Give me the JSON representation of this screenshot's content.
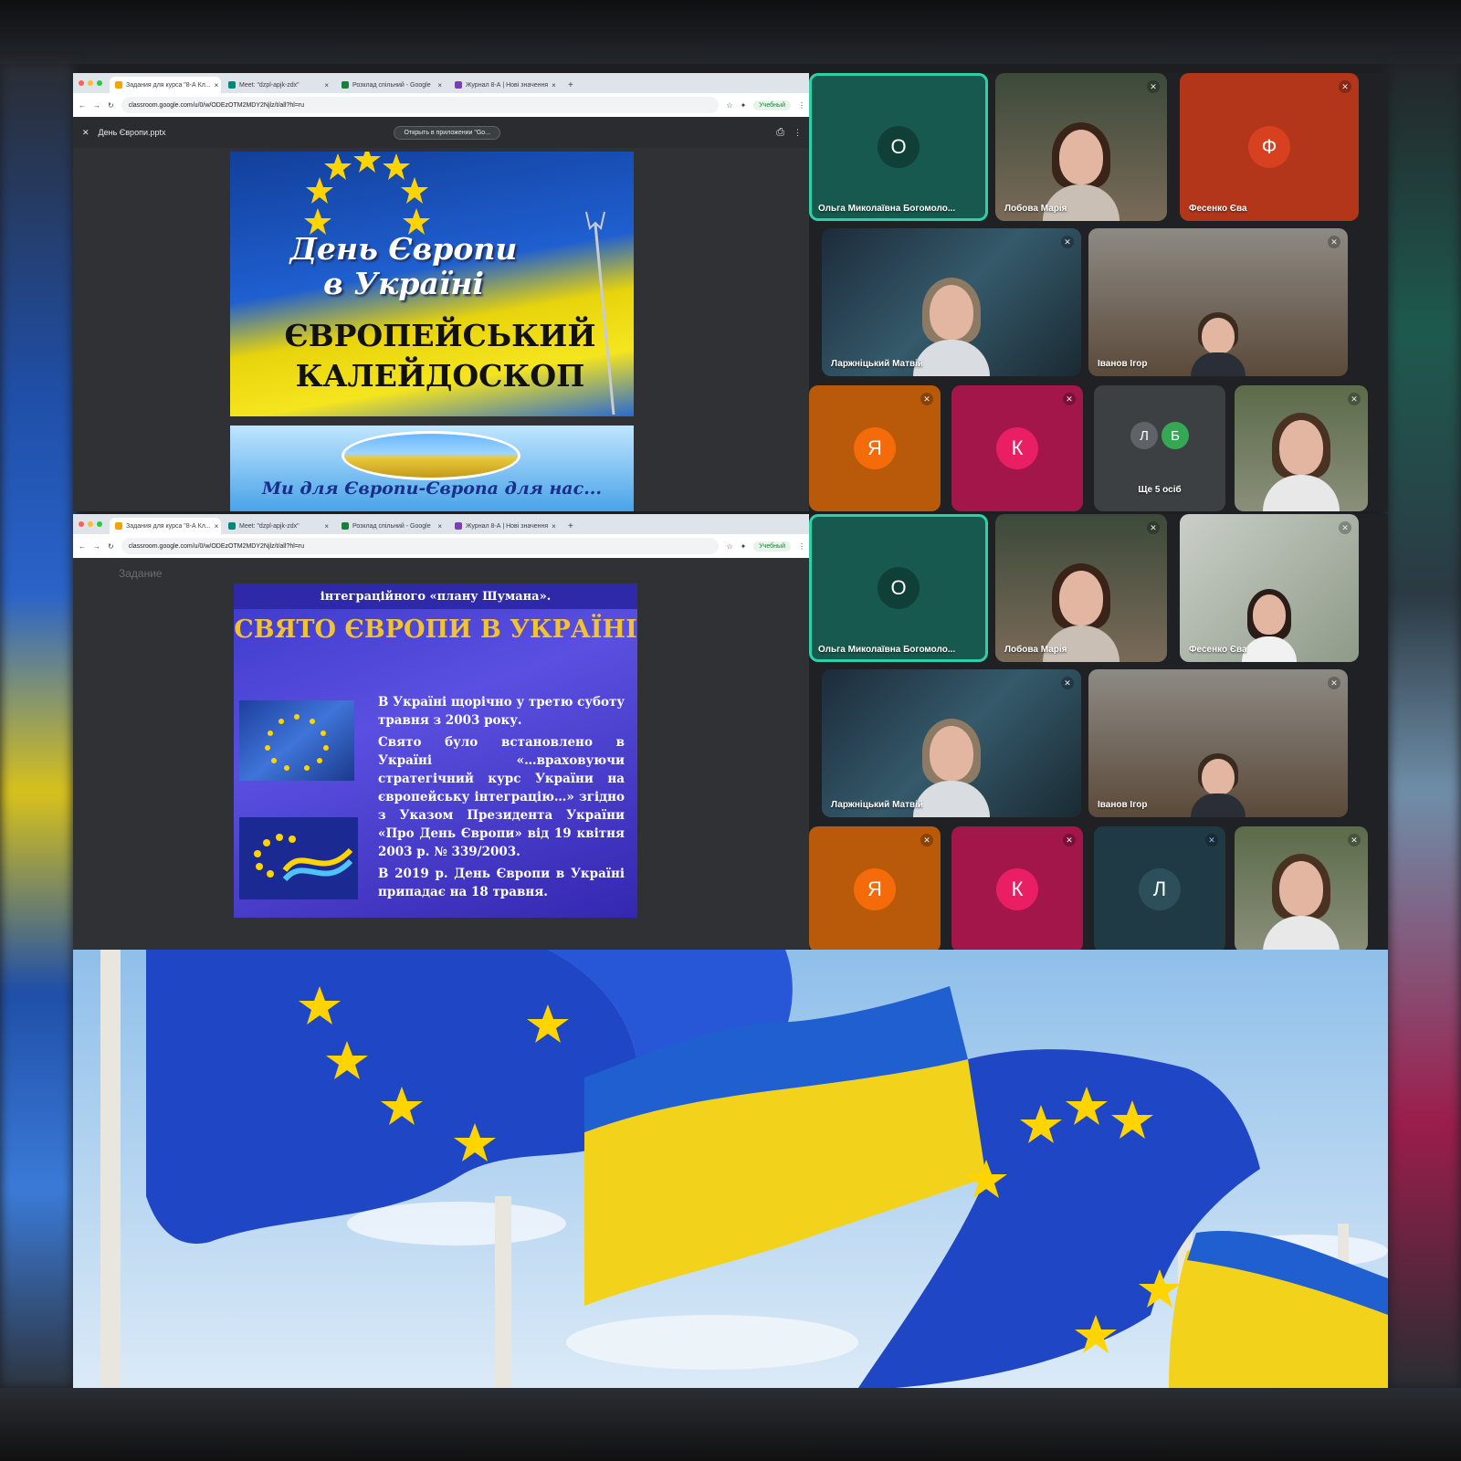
{
  "colors": {
    "eu_blue": "#1f46c4",
    "ua_yellow": "#f2d21a",
    "meet_teal": "#17594e",
    "avatar_orange": "#f56b0a",
    "avatar_pink": "#e91e63",
    "speaking": "#2fd0a8"
  },
  "screens": [
    {
      "tabs": [
        {
          "label": "Задания для курса \"8-А Кл...",
          "fav": "#f4a300"
        },
        {
          "label": "Meet: \"dzpl-apjk-zdx\"",
          "fav": "#00897b"
        },
        {
          "label": "Розклад спільний - Google",
          "fav": "#188038"
        },
        {
          "label": "Журнал 8-А | Нові значення",
          "fav": "#7b3fb5"
        }
      ],
      "url": "classroom.google.com/u/0/w/ODEzOTM2MDY2Njlz/t/all?hl=ru",
      "profile": "Учебный",
      "file_name": "День Європи.pptx",
      "open_button": "Открыть в приложении \"Go...",
      "slide": {
        "title": "День Європи в Україні",
        "subtitle": "ЄВРОПЕЙСЬКИЙ КАЛЕЙДОСКОП",
        "next_caption": "Ми для Європи-Європа для нас..."
      },
      "participants": [
        {
          "name": "Ольга Миколаївна Богомоло...",
          "initial": "О"
        },
        {
          "name": "Лобова Марія"
        },
        {
          "name": "Фесенко Єва",
          "initial": "Ф"
        },
        {
          "name": "Ларжніцький Матвій"
        },
        {
          "name": "Іванов Ігор"
        },
        {
          "initial": "Я"
        },
        {
          "initial": "К"
        },
        {
          "initials": [
            "Л",
            "Б"
          ],
          "label": "Ще 5 осіб"
        },
        {}
      ]
    },
    {
      "tabs": [
        {
          "label": "Задания для курса \"8-А Кл...",
          "fav": "#f4a300"
        },
        {
          "label": "Meet: \"dzpl-apjk-zdx\"",
          "fav": "#00897b"
        },
        {
          "label": "Розклад спільний - Google",
          "fav": "#188038"
        },
        {
          "label": "Журнал 8-А | Нові значення",
          "fav": "#7b3fb5"
        }
      ],
      "url": "classroom.google.com/u/0/w/ODEzOTM2MDY2Njlz/t/all?hl=ru",
      "profile": "Учебный",
      "view_title": "Задание",
      "slide": {
        "top_line": "інтеграційного «плану Шумана».",
        "heading": "СВЯТО ЄВРОПИ В УКРАЇНІ",
        "paragraphs": [
          "В Україні щорічно у третю суботу травня з 2003 року.",
          "Свято було встановлено в Україні «…враховуючи стратегічний курс України на європейську інтеграцію…» згідно з Указом Президента України «Про День Європи» від 19 квітня 2003 р. № 339/2003.",
          "В 2019 р. День Європи в Україні припадає на 18 травня."
        ]
      },
      "participants": [
        {
          "name": "Ольга Миколаївна Богомоло...",
          "initial": "О"
        },
        {
          "name": "Лобова Марія"
        },
        {
          "name": "Фесенко Єва"
        },
        {
          "name": "Ларжніцький Матвій"
        },
        {
          "name": "Іванов Ігор"
        },
        {
          "initial": "Я"
        },
        {
          "initial": "К"
        },
        {
          "initial": "Л"
        },
        {}
      ]
    }
  ]
}
